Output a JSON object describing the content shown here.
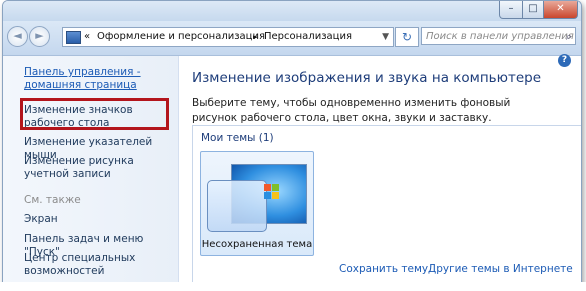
{
  "window": {
    "minimize_glyph": "–",
    "maximize_glyph": "□",
    "close_glyph": "✕"
  },
  "nav": {
    "back_glyph": "◄",
    "forward_glyph": "►",
    "breadcrumb_prefix": "«",
    "breadcrumb": [
      "Оформление и персонализация",
      "Персонализация"
    ],
    "separator": "►",
    "refresh_glyph": "↻",
    "search_placeholder": "Поиск в панели управления"
  },
  "sidebar": {
    "home_link": "Панель управления - домашняя страница",
    "items": [
      "Изменение значков рабочего стола",
      "Изменение указателей мыши",
      "Изменение рисунка учетной записи"
    ],
    "see_also_label": "См. также",
    "see_also": [
      "Экран",
      "Панель задач и меню \"Пуск\"",
      "Центр специальных возможностей"
    ]
  },
  "main": {
    "title": "Изменение изображения и звука на компьютере",
    "description": "Выберите тему, чтобы одновременно изменить фоновый рисунок рабочего стола, цвет окна, звуки и заставку.",
    "themes_header": "Мои темы (1)",
    "theme_name": "Несохраненная тема",
    "save_theme_link": "Сохранить тему",
    "other_themes_link": "Другие темы в Интернете"
  },
  "colors": {
    "highlight": "#b3151c",
    "link": "#1c5bb5",
    "title": "#1e3d7a"
  }
}
